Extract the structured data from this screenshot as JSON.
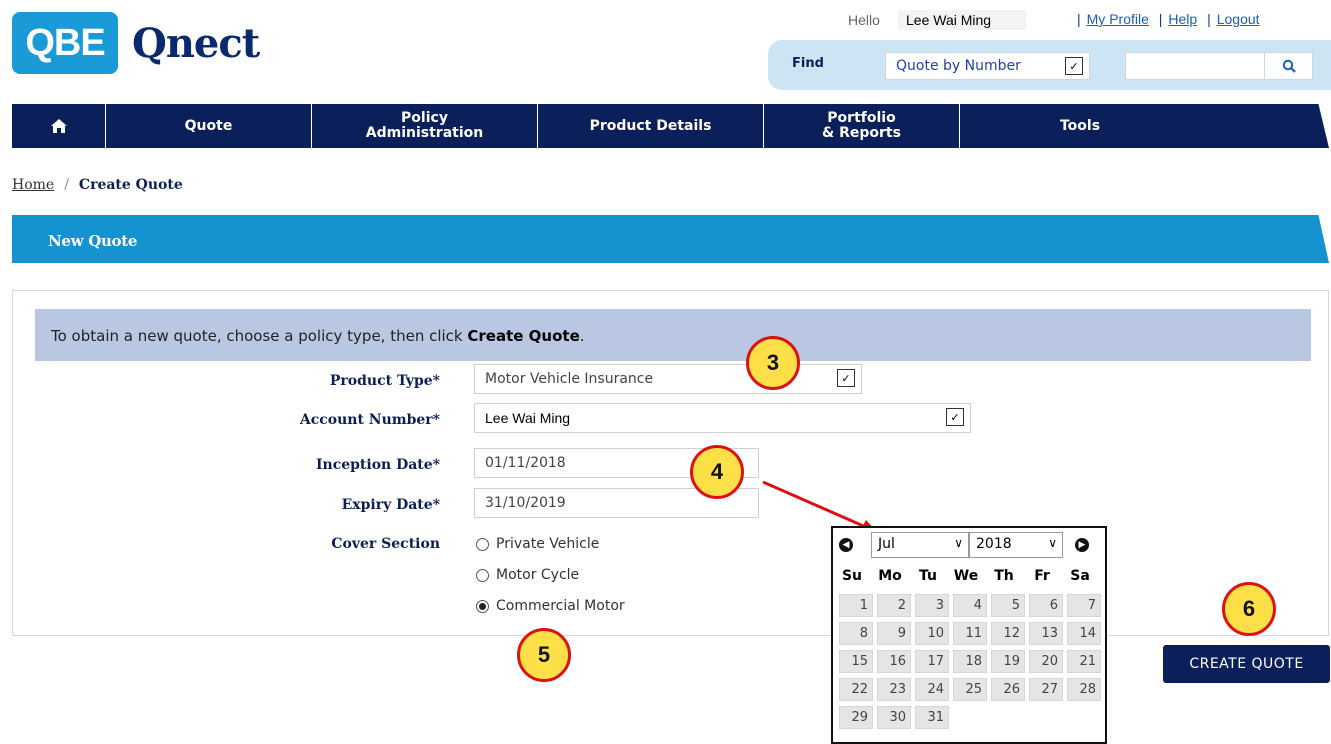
{
  "brand": {
    "logo_mark": "QBE",
    "logo_word": "Qnect",
    "color": "#1a9ad6"
  },
  "header": {
    "hello": "Hello",
    "user_name": "Lee Wai Ming",
    "links": [
      "My Profile",
      "Help",
      "Logout"
    ],
    "find_label": "Find",
    "find_option": "Quote by Number",
    "search_value": "",
    "search_icon": "search-icon"
  },
  "nav": {
    "home_icon": "home-icon",
    "items": [
      {
        "line1": "Quote",
        "line2": ""
      },
      {
        "line1": "Policy",
        "line2": "Administration"
      },
      {
        "line1": "Product Details",
        "line2": ""
      },
      {
        "line1": "Portfolio",
        "line2": "& Reports"
      },
      {
        "line1": "Tools",
        "line2": ""
      }
    ]
  },
  "breadcrumb": {
    "home": "Home",
    "separator": "/",
    "current": "Create Quote"
  },
  "section": {
    "title": "New Quote"
  },
  "form": {
    "intro_prefix": "To obtain a new quote, choose a policy type, then click ",
    "intro_bold": "Create Quote",
    "intro_suffix": ".",
    "product_type_label": "Product Type*",
    "product_type_value": "Motor Vehicle Insurance",
    "account_label": "Account Number*",
    "account_value": "Lee Wai Ming",
    "inception_label": "Inception Date*",
    "inception_value": "01/11/2018",
    "expiry_label": "Expiry Date*",
    "expiry_value": "31/10/2019",
    "cover_label": "Cover Section",
    "cover_options": [
      "Private Vehicle",
      "Motor Cycle",
      "Commercial Motor"
    ],
    "cover_selected": "Commercial Motor"
  },
  "calendar": {
    "month": "Jul",
    "year": "2018",
    "weekdays": [
      "Su",
      "Mo",
      "Tu",
      "We",
      "Th",
      "Fr",
      "Sa"
    ],
    "days": [
      "1",
      "2",
      "3",
      "4",
      "5",
      "6",
      "7",
      "8",
      "9",
      "10",
      "11",
      "12",
      "13",
      "14",
      "15",
      "16",
      "17",
      "18",
      "19",
      "20",
      "21",
      "22",
      "23",
      "24",
      "25",
      "26",
      "27",
      "28",
      "29",
      "30",
      "31"
    ]
  },
  "create_button": "CREATE QUOTE",
  "callouts": [
    "3",
    "4",
    "5",
    "6"
  ],
  "colors": {
    "navy": "#0b1f5a",
    "blue": "#1592d0",
    "intro_bg": "#bac7e3",
    "callout_fill": "#fde047",
    "callout_border": "#dd1111"
  }
}
